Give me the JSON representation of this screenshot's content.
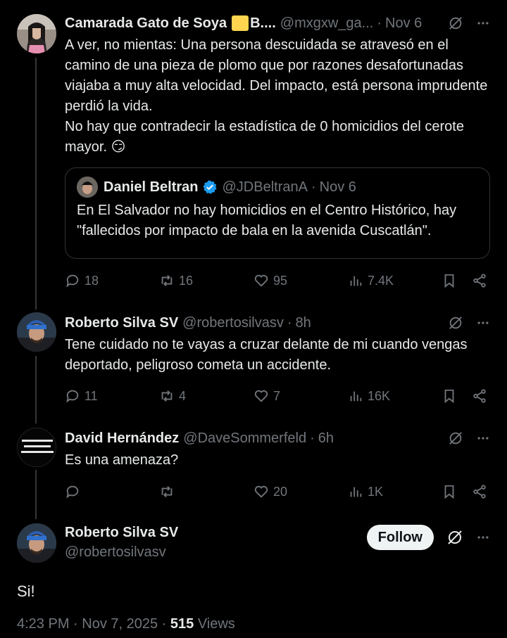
{
  "tweets": [
    {
      "name": "Camarada Gato de Soya",
      "badge_text": "B....",
      "handle": "@mxgxw_ga...",
      "time": "Nov 6",
      "text": "A ver, no mientas: Una persona descuidada se atravesó en el camino de una pieza de plomo que por razones desafortunadas viajaba a muy alta velocidad. Del impacto, está persona imprudente perdió la vida.\nNo hay que contradecir la estadística de 0 homicidios del cerote mayor. 😏",
      "quote": {
        "name": "Daniel Beltran",
        "handle": "@JDBeltranA",
        "time": "Nov 6",
        "text": "En El Salvador no hay homicidios en el Centro Histórico, hay \"fallecidos por impacto de bala en la avenida Cuscatlán\"."
      },
      "replies": "18",
      "reposts": "16",
      "likes": "95",
      "views": "7.4K"
    },
    {
      "name": "Roberto Silva SV",
      "handle": "@robertosilvasv",
      "time": "8h",
      "text": "Tene cuidado no te vayas a cruzar delante de mi cuando vengas deportado, peligroso cometa un accidente.",
      "replies": "11",
      "reposts": "4",
      "likes": "7",
      "views": "16K"
    },
    {
      "name": "David Hernández",
      "handle": "@DaveSommerfeld",
      "time": "6h",
      "avatar_text": "BUKELE GENERA DESEMPLEO, POBREZA Y MUERTE",
      "text": "Es una amenaza?",
      "replies": "",
      "reposts": "",
      "likes": "20",
      "views": "1K"
    }
  ],
  "main_tweet": {
    "name": "Roberto Silva SV",
    "handle": "@robertosilvasv",
    "follow_label": "Follow",
    "text": "Si!",
    "timestamp": "4:23 PM · Nov 7, 2025 · ",
    "views_count": "515",
    "views_label": " Views"
  },
  "colors": {
    "background": "#000000",
    "text": "#e7e9ea",
    "muted": "#71767b",
    "verified": "#1d9bf0",
    "badge": "#ffd54f"
  },
  "icons": [
    "grok-icon",
    "more-icon",
    "reply-icon",
    "repost-icon",
    "like-icon",
    "views-icon",
    "bookmark-icon",
    "share-icon",
    "verified-icon"
  ]
}
